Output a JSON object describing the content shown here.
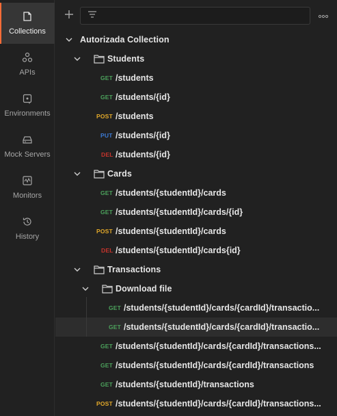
{
  "sidebar": {
    "items": [
      {
        "label": "Collections",
        "icon": "collections-icon",
        "active": true
      },
      {
        "label": "APIs",
        "icon": "apis-icon",
        "active": false
      },
      {
        "label": "Environments",
        "icon": "environments-icon",
        "active": false
      },
      {
        "label": "Mock Servers",
        "icon": "mock-servers-icon",
        "active": false
      },
      {
        "label": "Monitors",
        "icon": "monitors-icon",
        "active": false
      },
      {
        "label": "History",
        "icon": "history-icon",
        "active": false
      }
    ]
  },
  "toolbar": {
    "add_icon": "plus-icon",
    "filter_icon": "filter-icon",
    "filter_value": "",
    "filter_placeholder": "",
    "more_icon": "more-icon"
  },
  "tree": {
    "collection": {
      "name": "Autorizada Collection"
    },
    "students": {
      "name": "Students",
      "requests": [
        {
          "method": "GET",
          "path": "/students"
        },
        {
          "method": "GET",
          "path": "/students/{id}"
        },
        {
          "method": "POST",
          "path": "/students"
        },
        {
          "method": "PUT",
          "path": "/students/{id}"
        },
        {
          "method": "DEL",
          "path": "/students/{id}"
        }
      ]
    },
    "cards": {
      "name": "Cards",
      "requests": [
        {
          "method": "GET",
          "path": "/students/{studentId}/cards"
        },
        {
          "method": "GET",
          "path": "/students/{studentId}/cards/{id}"
        },
        {
          "method": "POST",
          "path": "/students/{studentId}/cards"
        },
        {
          "method": "DEL",
          "path": "/students/{studentId}/cards{id}"
        }
      ]
    },
    "transactions": {
      "name": "Transactions",
      "download": {
        "name": "Download file",
        "requests": [
          {
            "method": "GET",
            "path": "/students/{studentId}/cards/{cardId}/transactio..."
          },
          {
            "method": "GET",
            "path": "/students/{studentId}/cards/{cardId}/transactio..."
          }
        ]
      },
      "requests": [
        {
          "method": "GET",
          "path": "/students/{studentId}/cards/{cardId}/transactions..."
        },
        {
          "method": "GET",
          "path": "/students/{studentId}/cards/{cardId}/transactions"
        },
        {
          "method": "GET",
          "path": "/students/{studentId}/transactions"
        },
        {
          "method": "POST",
          "path": "/students/{studentId}/cards/{cardId}/transactions..."
        }
      ]
    }
  },
  "colors": {
    "accent": "#ff6c37",
    "get": "#4ca25c",
    "post": "#e3a92a",
    "put": "#3c7bd6",
    "del": "#c7342c"
  }
}
